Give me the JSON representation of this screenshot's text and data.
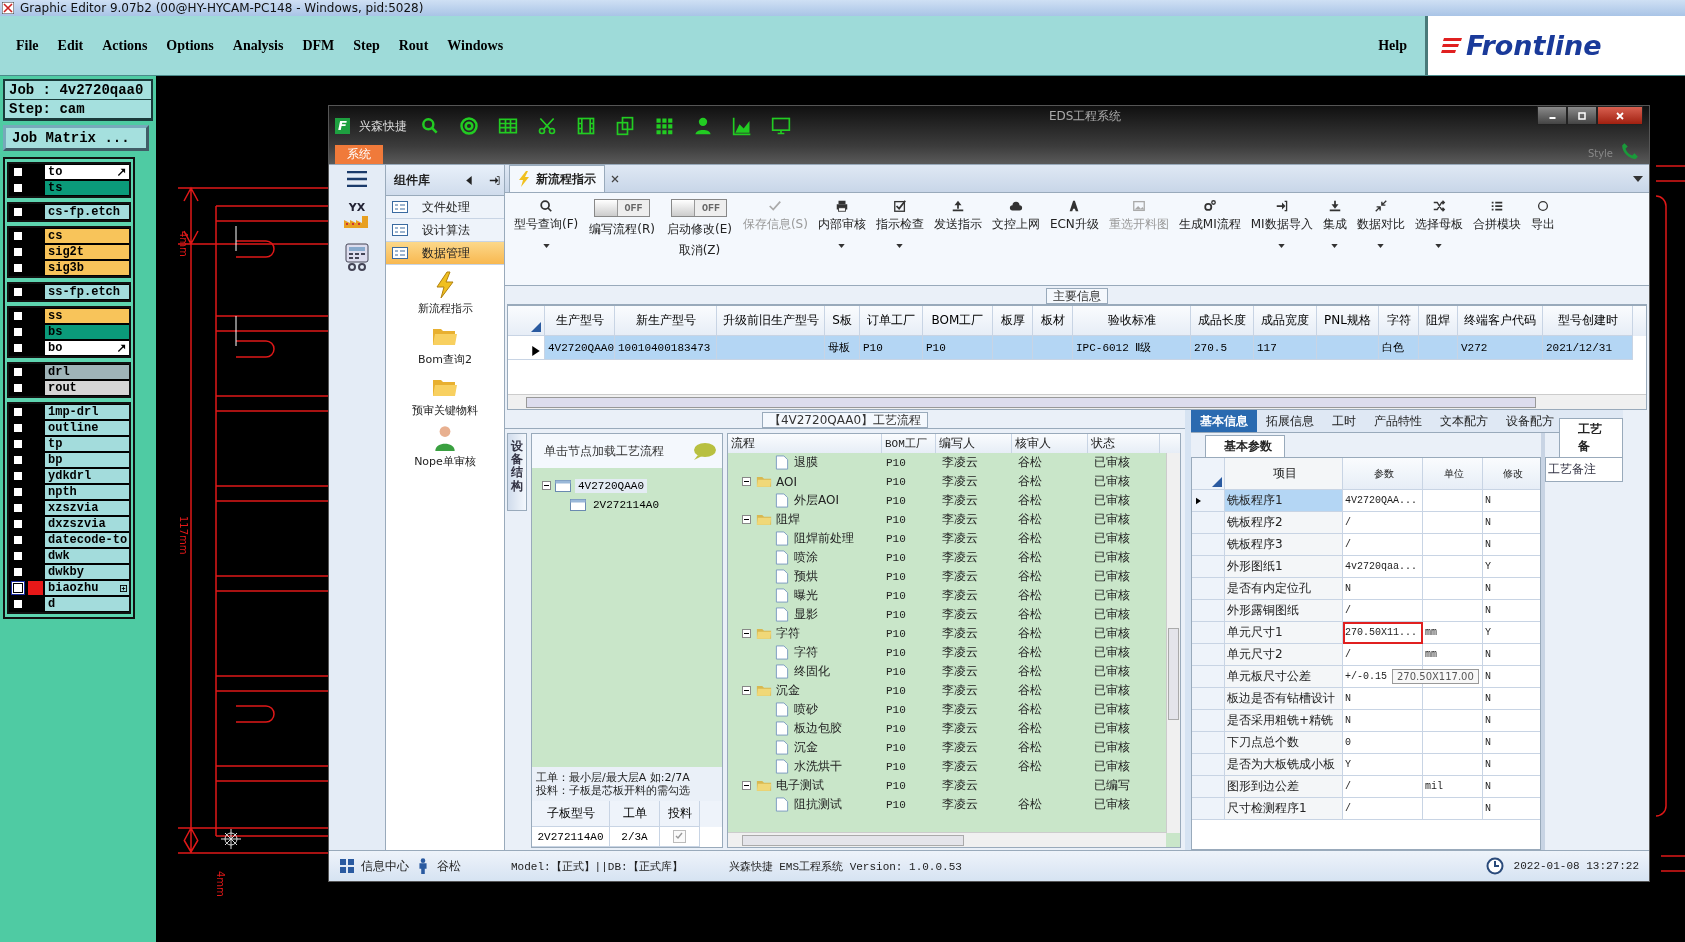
{
  "app": {
    "title": "Graphic Editor 9.07b2 (00@HY-HYCAM-PC148 - Windows, pid:5028)"
  },
  "menu": [
    "File",
    "Edit",
    "Actions",
    "Options",
    "Analysis",
    "DFM",
    "Step",
    "Rout",
    "Windows"
  ],
  "help": "Help",
  "logo": "Frontline",
  "job": {
    "job": "Job : 4v2720qaa0",
    "step": "Step: cam",
    "matrix_button": "Job Matrix ..."
  },
  "layer_groups": [
    {
      "layers": [
        {
          "name": "to",
          "color": "#ffffff",
          "arrow": true,
          "selected": false,
          "checked": false
        },
        {
          "name": "ts",
          "color": "#0b9a7a",
          "arrow": false,
          "selected": false,
          "checked": false
        }
      ]
    },
    {
      "layers": [
        {
          "name": "cs-fp.etch",
          "color": "#a3dcdc",
          "arrow": false,
          "selected": false,
          "checked": false
        }
      ]
    },
    {
      "layers": [
        {
          "name": "cs",
          "color": "#f8c45a",
          "arrow": false,
          "selected": false,
          "checked": false
        },
        {
          "name": "sig2t",
          "color": "#f8c45a",
          "arrow": false,
          "selected": false,
          "checked": false
        },
        {
          "name": "sig3b",
          "color": "#f8c45a",
          "arrow": false,
          "selected": false,
          "checked": false
        }
      ]
    },
    {
      "layers": [
        {
          "name": "ss-fp.etch",
          "color": "#a3dcdc",
          "arrow": false,
          "selected": false,
          "checked": false
        }
      ]
    },
    {
      "layers": [
        {
          "name": "ss",
          "color": "#f8c45a",
          "arrow": false,
          "selected": false,
          "checked": false
        },
        {
          "name": "bs",
          "color": "#0b9a7a",
          "arrow": false,
          "selected": false,
          "checked": false
        },
        {
          "name": "bo",
          "color": "#ffffff",
          "arrow": true,
          "selected": false,
          "checked": false
        }
      ]
    },
    {
      "layers": [
        {
          "name": "drl",
          "color": "#9fb4b8",
          "arrow": false,
          "selected": false,
          "checked": false
        },
        {
          "name": "rout",
          "color": "#d6d6d6",
          "arrow": false,
          "selected": false,
          "checked": false
        }
      ]
    },
    {
      "layers": [
        {
          "name": "1mp-drl",
          "color": "#a3dcdc",
          "arrow": false,
          "selected": false,
          "checked": false
        },
        {
          "name": "outline",
          "color": "#a3dcdc",
          "arrow": false,
          "selected": false,
          "checked": false
        },
        {
          "name": "tp",
          "color": "#a3dcdc",
          "arrow": false,
          "selected": false,
          "checked": false
        },
        {
          "name": "bp",
          "color": "#a3dcdc",
          "arrow": false,
          "selected": false,
          "checked": false
        },
        {
          "name": "ydkdrl",
          "color": "#a3dcdc",
          "arrow": false,
          "selected": false,
          "checked": false
        },
        {
          "name": "npth",
          "color": "#a3dcdc",
          "arrow": false,
          "selected": false,
          "checked": false
        },
        {
          "name": "xzszvia",
          "color": "#a3dcdc",
          "arrow": false,
          "selected": false,
          "checked": false
        },
        {
          "name": "dxzszvia",
          "color": "#a3dcdc",
          "arrow": false,
          "selected": false,
          "checked": false
        },
        {
          "name": "datecode-to",
          "color": "#a3dcdc",
          "arrow": false,
          "selected": false,
          "checked": false
        },
        {
          "name": "dwk",
          "color": "#a3dcdc",
          "arrow": false,
          "selected": false,
          "checked": false
        },
        {
          "name": "dwkby",
          "color": "#a3dcdc",
          "arrow": false,
          "selected": false,
          "checked": false
        },
        {
          "name": "biaozhu",
          "color": "#a3dcdc",
          "arrow": false,
          "selected": true,
          "checked": false
        },
        {
          "name": "d",
          "color": "#a3dcdc",
          "arrow": false,
          "selected": false,
          "checked": false
        }
      ]
    }
  ],
  "canvas": {
    "dimension_labels": [
      "4mm",
      "117mm",
      "4mm"
    ]
  },
  "eds": {
    "badge": "F",
    "quick_label": "兴森快捷",
    "title": "EDS工程系统",
    "system_tab": "系统",
    "style_label": "Style",
    "yx_label": "YX",
    "side_panel": {
      "title": "组件库",
      "categories": [
        {
          "label": "文件处理",
          "selected": false
        },
        {
          "label": "设计算法",
          "selected": false
        },
        {
          "label": "数据管理",
          "selected": true
        }
      ],
      "tools": [
        {
          "label": "新流程指示"
        },
        {
          "label": "Bom查询2"
        },
        {
          "label": "预审关键物料"
        },
        {
          "label": "Nope单审核"
        }
      ]
    },
    "doc_tab": "新流程指示",
    "ribbon": [
      {
        "kind": "button",
        "label": "型号查询(F)",
        "dropdown": true,
        "disabled": false
      },
      {
        "kind": "toggle",
        "switch_text": "OFF",
        "on": false,
        "label": "编写流程(R)"
      },
      {
        "kind": "toggle",
        "switch_text": "OFF",
        "on": false,
        "label": "启动修改(E)",
        "second_label": "取消(Z)"
      },
      {
        "kind": "button",
        "label": "保存信息(S)",
        "dropdown": false,
        "disabled": true
      },
      {
        "kind": "button",
        "label": "内部审核",
        "dropdown": true,
        "disabled": false
      },
      {
        "kind": "button",
        "label": "指示检查",
        "dropdown": true,
        "disabled": false
      },
      {
        "kind": "button",
        "label": "发送指示",
        "dropdown": false,
        "disabled": false
      },
      {
        "kind": "button",
        "label": "文控上网",
        "dropdown": false,
        "disabled": false
      },
      {
        "kind": "button",
        "label": "ECN升级",
        "dropdown": false,
        "disabled": false
      },
      {
        "kind": "button",
        "label": "重选开料图",
        "dropdown": false,
        "disabled": true
      },
      {
        "kind": "button",
        "label": "生成MI流程",
        "dropdown": false,
        "disabled": false
      },
      {
        "kind": "button",
        "label": "MI数据导入",
        "dropdown": true,
        "disabled": false
      },
      {
        "kind": "button",
        "label": "集成",
        "dropdown": true,
        "disabled": false
      },
      {
        "kind": "button",
        "label": "数据对比",
        "dropdown": true,
        "disabled": false
      },
      {
        "kind": "button",
        "label": "选择母板",
        "dropdown": true,
        "disabled": false
      },
      {
        "kind": "button",
        "label": "合拼模块",
        "dropdown": false,
        "disabled": false
      },
      {
        "kind": "button",
        "label": "导出",
        "dropdown": false,
        "disabled": false
      }
    ],
    "main_info": {
      "title": "主要信息",
      "columns": [
        "生产型号",
        "新生产型号",
        "升级前旧生产型号",
        "S板",
        "订单工厂",
        "BOM工厂",
        "板厚",
        "板材",
        "验收标准",
        "成品长度",
        "成品宽度",
        "PNL规格",
        "字符",
        "阻焊",
        "终端客户代码",
        "型号创建时"
      ],
      "rows": [
        {
          "selected": true,
          "cells": [
            "4V2720QAA0",
            "10010400183473",
            null,
            "母板",
            "P10",
            "P10",
            null,
            null,
            "IPC-6012 Ⅱ级",
            "270.5",
            "117",
            null,
            "白色",
            null,
            "V272",
            "2021/12/31"
          ]
        }
      ]
    },
    "flow_title": "【4V2720QAA0】工艺流程",
    "structure_tab": "设备结构",
    "tree_hint": "单击节点加载工艺流程",
    "tree": [
      {
        "label": "4V2720QAA0",
        "selected": true,
        "children": [
          {
            "label": "2V272114A0",
            "selected": false
          }
        ]
      }
    ],
    "note": [
      "工单：最小层/最大层A 如:2/7A",
      "投料：子板是芯板开料的需勾选"
    ],
    "sub_table": {
      "columns": [
        "子板型号",
        "工单",
        "投料"
      ],
      "rows": [
        {
          "board": "2V272114A0",
          "order": "2/3A",
          "checked": true
        }
      ]
    },
    "flow_table": {
      "columns": [
        "流程",
        "BOM工厂",
        "编写人",
        "核审人",
        "状态"
      ],
      "rows": [
        {
          "kind": "step",
          "name": "退膜",
          "bom": "P10",
          "writer": "李凌云",
          "reviewer": "谷松",
          "status": "已审核"
        },
        {
          "kind": "group",
          "name": "AOI",
          "bom": "P10",
          "writer": "李凌云",
          "reviewer": "谷松",
          "status": "已审核",
          "children": [
            {
              "kind": "step",
              "name": "外层AOI",
              "bom": "P10",
              "writer": "李凌云",
              "reviewer": "谷松",
              "status": "已审核"
            }
          ]
        },
        {
          "kind": "group",
          "name": "阻焊",
          "bom": "P10",
          "writer": "李凌云",
          "reviewer": "谷松",
          "status": "已审核",
          "children": [
            {
              "kind": "step",
              "name": "阻焊前处理",
              "bom": "P10",
              "writer": "李凌云",
              "reviewer": "谷松",
              "status": "已审核"
            },
            {
              "kind": "step",
              "name": "喷涂",
              "bom": "P10",
              "writer": "李凌云",
              "reviewer": "谷松",
              "status": "已审核"
            },
            {
              "kind": "step",
              "name": "预烘",
              "bom": "P10",
              "writer": "李凌云",
              "reviewer": "谷松",
              "status": "已审核"
            },
            {
              "kind": "step",
              "name": "曝光",
              "bom": "P10",
              "writer": "李凌云",
              "reviewer": "谷松",
              "status": "已审核"
            },
            {
              "kind": "step",
              "name": "显影",
              "bom": "P10",
              "writer": "李凌云",
              "reviewer": "谷松",
              "status": "已审核"
            }
          ]
        },
        {
          "kind": "group",
          "name": "字符",
          "bom": "P10",
          "writer": "李凌云",
          "reviewer": "谷松",
          "status": "已审核",
          "children": [
            {
              "kind": "step",
              "name": "字符",
              "bom": "P10",
              "writer": "李凌云",
              "reviewer": "谷松",
              "status": "已审核"
            },
            {
              "kind": "step",
              "name": "终固化",
              "bom": "P10",
              "writer": "李凌云",
              "reviewer": "谷松",
              "status": "已审核"
            }
          ]
        },
        {
          "kind": "group",
          "name": "沉金",
          "bom": "P10",
          "writer": "李凌云",
          "reviewer": "谷松",
          "status": "已审核",
          "children": [
            {
              "kind": "step",
              "name": "喷砂",
              "bom": "P10",
              "writer": "李凌云",
              "reviewer": "谷松",
              "status": "已审核"
            },
            {
              "kind": "step",
              "name": "板边包胶",
              "bom": "P10",
              "writer": "李凌云",
              "reviewer": "谷松",
              "status": "已审核"
            },
            {
              "kind": "step",
              "name": "沉金",
              "bom": "P10",
              "writer": "李凌云",
              "reviewer": "谷松",
              "status": "已审核"
            },
            {
              "kind": "step",
              "name": "水洗烘干",
              "bom": "P10",
              "writer": "李凌云",
              "reviewer": "谷松",
              "status": "已审核"
            }
          ]
        },
        {
          "kind": "group",
          "name": "电子测试",
          "bom": "P10",
          "writer": "李凌云",
          "status": "已编写",
          "children": [
            {
              "kind": "step",
              "name": "阻抗测试",
              "bom": "P10",
              "writer": "李凌云",
              "reviewer": "谷松",
              "status": "已审核"
            }
          ]
        }
      ]
    },
    "params": {
      "tabs": [
        {
          "label": "基本信息",
          "selected": true
        },
        {
          "label": "拓展信息",
          "selected": false
        },
        {
          "label": "工时",
          "selected": false
        },
        {
          "label": "产品特性",
          "selected": false
        },
        {
          "label": "文本配方",
          "selected": false
        },
        {
          "label": "设备配方",
          "selected": false
        }
      ],
      "subtab": "基本参数",
      "side_title": "工艺备",
      "side_item": "工艺备注",
      "columns": [
        "项目",
        "参数",
        "单位",
        "修改"
      ],
      "rows": [
        {
          "item": "铣板程序1",
          "value": "4V2720QAA...",
          "modified": "N",
          "selected": true,
          "highlighted": false
        },
        {
          "item": "铣板程序2",
          "value": "/",
          "modified": "N",
          "selected": false,
          "highlighted": false
        },
        {
          "item": "铣板程序3",
          "value": "/",
          "modified": "N",
          "selected": false,
          "highlighted": false
        },
        {
          "item": "外形图纸1",
          "value": "4v2720qaa...",
          "modified": "Y",
          "selected": false,
          "highlighted": false
        },
        {
          "item": "是否有内定位孔",
          "value": "N",
          "modified": "N",
          "selected": false,
          "highlighted": false
        },
        {
          "item": "外形露铜图纸",
          "value": "/",
          "modified": "N",
          "selected": false,
          "highlighted": false
        },
        {
          "item": "单元尺寸1",
          "value": "270.50X11...",
          "unit": "mm",
          "modified": "Y",
          "selected": false,
          "highlighted": true
        },
        {
          "item": "单元尺寸2",
          "value": "/",
          "unit": "mm",
          "modified": "N",
          "selected": false,
          "highlighted": false
        },
        {
          "item": "单元板尺寸公差",
          "value": "+/-0.15",
          "modified": "N",
          "selected": false,
          "highlighted": false
        },
        {
          "item": "板边是否有钻槽设计",
          "value": "N",
          "modified": "N",
          "selected": false,
          "highlighted": false
        },
        {
          "item": "是否采用粗铣+精铣",
          "value": "N",
          "modified": "N",
          "selected": false,
          "highlighted": false
        },
        {
          "item": "下刀点总个数",
          "value": "0",
          "modified": "N",
          "selected": false,
          "highlighted": false
        },
        {
          "item": "是否为大板铣成小板",
          "value": "Y",
          "modified": "N",
          "selected": false,
          "highlighted": false
        },
        {
          "item": "图形到边公差",
          "value": "/",
          "unit": "mil",
          "modified": "N",
          "selected": false,
          "highlighted": false
        },
        {
          "item": "尺寸检测程序1",
          "value": "/",
          "modified": "N",
          "selected": false,
          "highlighted": false
        }
      ],
      "tooltip": "270.50X117.00"
    },
    "status": {
      "info": "信息中心",
      "user": "谷松",
      "model": "Model:【正式】||DB:【正式库】",
      "version": "兴森快捷 EMS工程系统 Version: 1.0.0.53",
      "datetime": "2022-01-08 13:27:22"
    }
  }
}
